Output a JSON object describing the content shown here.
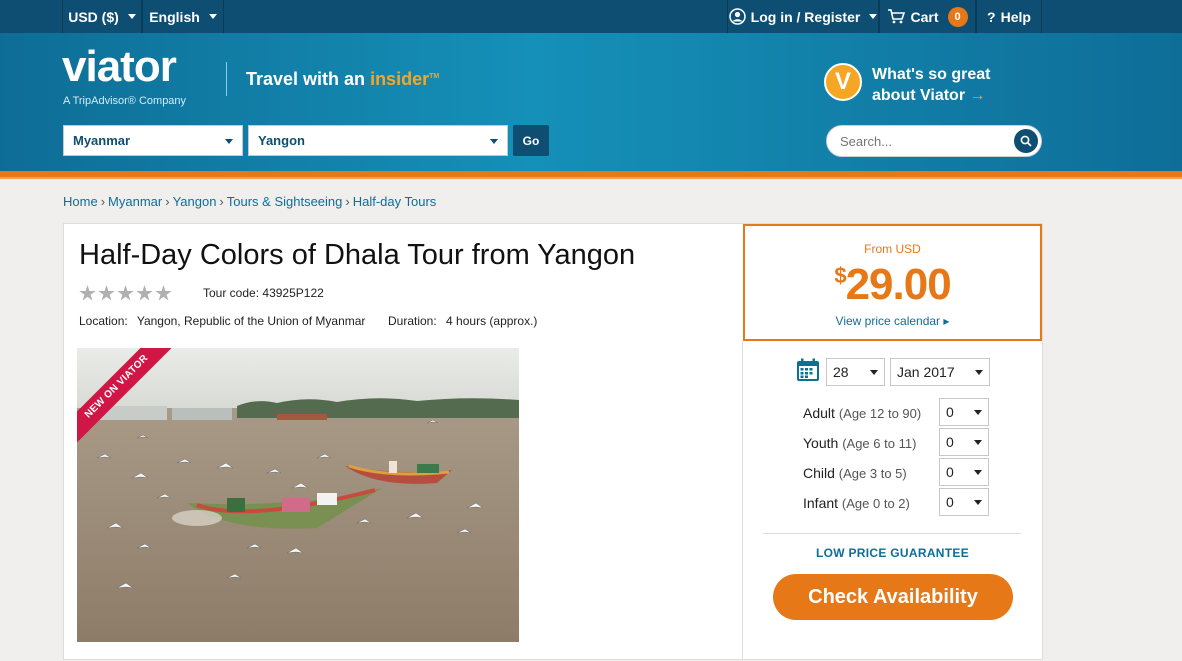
{
  "topbar": {
    "currency": "USD ($)",
    "language": "English",
    "login": "Log in / Register",
    "cart_label": "Cart",
    "cart_count": "0",
    "help": "Help"
  },
  "header": {
    "logo": "viator",
    "logo_sub": "A TripAdvisor® Company",
    "tagline_prefix": "Travel with an",
    "tagline_highlight": "insider",
    "tagline_tm": "TM",
    "country_select": "Myanmar",
    "city_select": "Yangon",
    "go_label": "Go",
    "whats_badge": "V",
    "whats_line1": "What's so great",
    "whats_line2": "about Viator",
    "search_placeholder": "Search..."
  },
  "breadcrumb": [
    "Home",
    "Myanmar",
    "Yangon",
    "Tours & Sightseeing",
    "Half-day Tours"
  ],
  "product": {
    "title": "Half-Day Colors of Dhala Tour from Yangon",
    "rating_stars": 0,
    "tour_code_label": "Tour code:",
    "tour_code": "43925P122",
    "location_label": "Location:",
    "location": "Yangon, Republic of the Union of Myanmar",
    "duration_label": "Duration:",
    "duration": "4 hours (approx.)",
    "ribbon": "NEW ON VIATOR"
  },
  "booking": {
    "from_label": "From USD",
    "currency_symbol": "$",
    "price": "29.00",
    "calendar_link": "View price calendar",
    "day": "28",
    "month": "Jan 2017",
    "travelers": [
      {
        "label": "Adult",
        "age": "(Age 12 to 90)",
        "count": "0"
      },
      {
        "label": "Youth",
        "age": "(Age 6 to 11)",
        "count": "0"
      },
      {
        "label": "Child",
        "age": "(Age 3 to 5)",
        "count": "0"
      },
      {
        "label": "Infant",
        "age": "(Age 0 to 2)",
        "count": "0"
      }
    ],
    "guarantee": "LOW PRICE GUARANTEE",
    "check_button": "Check Availability"
  },
  "colors": {
    "brand_blue": "#0e6e98",
    "brand_dark": "#0e4e73",
    "accent_orange": "#e77817",
    "ribbon_red": "#d01645"
  }
}
